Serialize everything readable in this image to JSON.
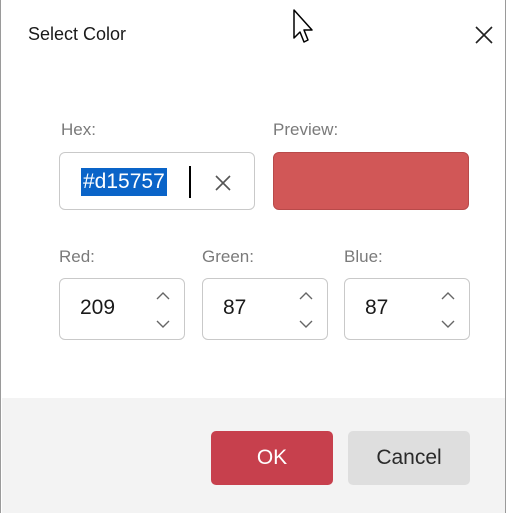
{
  "dialog": {
    "title": "Select Color"
  },
  "hex": {
    "label": "Hex:",
    "value": "#d15757"
  },
  "preview": {
    "label": "Preview:",
    "color": "#d15757"
  },
  "rgb": {
    "red": {
      "label": "Red:",
      "value": "209"
    },
    "green": {
      "label": "Green:",
      "value": "87"
    },
    "blue": {
      "label": "Blue:",
      "value": "87"
    }
  },
  "buttons": {
    "ok": "OK",
    "cancel": "Cancel"
  },
  "colors": {
    "accent": "#c7404d",
    "selection": "#0a64c8",
    "footer": "#f3f3f3"
  },
  "icons": {
    "close": "close-icon",
    "clear": "clear-icon",
    "spin_up": "chevron-up-icon",
    "spin_down": "chevron-down-icon",
    "cursor": "mouse-pointer-icon"
  }
}
